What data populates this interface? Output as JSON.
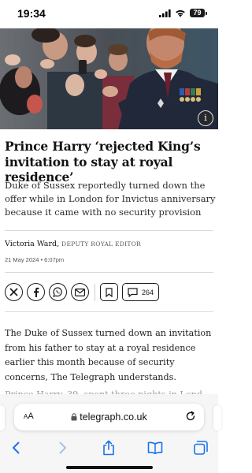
{
  "status_bar": {
    "time": "19:34",
    "battery": "79"
  },
  "hero_image": {
    "description_icon": "info-icon",
    "info_label": "i"
  },
  "article": {
    "headline": "Prince Harry ‘rejected King’s invitation to stay at royal residence’",
    "standfirst": "Duke of Sussex reportedly turned down the offer while in London for Invictus anniversary because it came with no security provision",
    "author": "Victoria Ward,",
    "author_role": "DEPUTY ROYAL EDITOR",
    "date": "21 May 2024 • 6:07pm",
    "body_paragraph": "The Duke of Sussex turned down an invitation from his father to stay at a royal residence earlier this month because of security concerns, The Telegraph understands.",
    "body_next_line_partial": "Prince Harry, 39, spent three nights in Lond"
  },
  "share": {
    "buttons": [
      "x-icon",
      "facebook-icon",
      "whatsapp-icon",
      "email-icon"
    ],
    "bookmark_icon": "bookmark-icon",
    "comments_icon": "comment-icon",
    "comments_count": "264"
  },
  "browser": {
    "text_size_label_small": "A",
    "text_size_label_large": "A",
    "url": "telegraph.co.uk",
    "lock_icon": "lock-icon",
    "reload_icon": "reload-icon",
    "toolbar": [
      "back-icon",
      "forward-icon",
      "share-icon",
      "bookmarks-icon",
      "tabs-icon"
    ]
  },
  "colors": {
    "accent_blue": "#1a73e8",
    "text": "#121212",
    "divider": "#d9d9d9"
  }
}
